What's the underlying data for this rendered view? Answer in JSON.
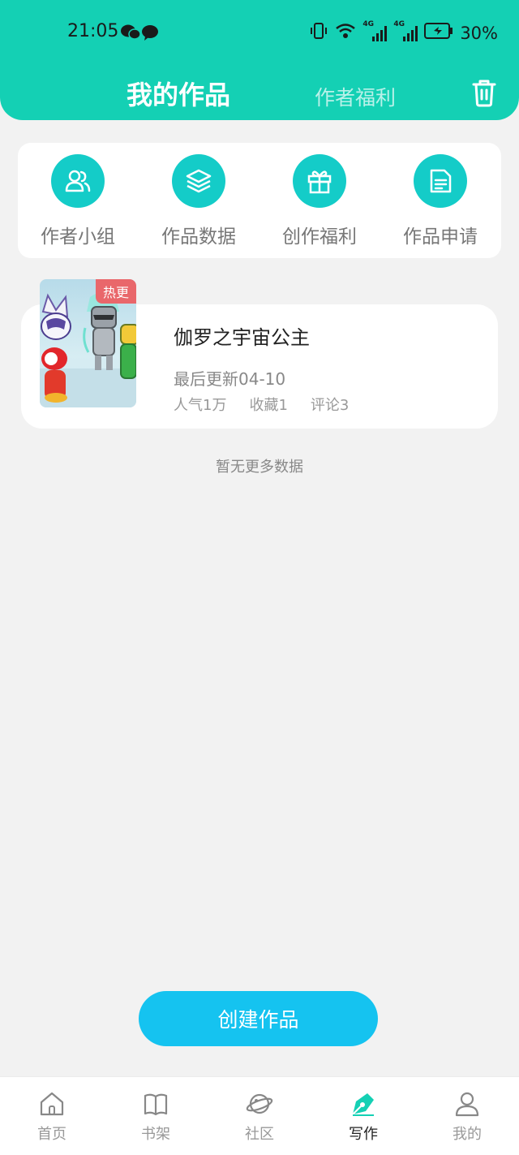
{
  "status_bar": {
    "time": "21:05",
    "network_1": "4G",
    "network_2": "4G",
    "battery": "30%"
  },
  "header": {
    "title": "我的作品",
    "subtitle_tab": "作者福利",
    "trash_icon": "trash-icon",
    "bg_color": "#14d0b4"
  },
  "quick_actions": [
    {
      "label": "作者小组",
      "icon": "group-icon"
    },
    {
      "label": "作品数据",
      "icon": "layers-icon"
    },
    {
      "label": "创作福利",
      "icon": "gift-icon"
    },
    {
      "label": "作品申请",
      "icon": "document-icon"
    }
  ],
  "works": [
    {
      "badge": "热更",
      "title": "伽罗之宇宙公主",
      "last_update": "最后更新04-10",
      "popularity": "人气1万",
      "favorites": "收藏1",
      "comments": "评论3"
    }
  ],
  "no_more_text": "暂无更多数据",
  "create_button": "创建作品",
  "bottom_nav": [
    {
      "label": "首页",
      "icon": "home-icon",
      "active": false
    },
    {
      "label": "书架",
      "icon": "book-icon",
      "active": false
    },
    {
      "label": "社区",
      "icon": "planet-icon",
      "active": false
    },
    {
      "label": "写作",
      "icon": "pen-icon",
      "active": true
    },
    {
      "label": "我的",
      "icon": "user-icon",
      "active": false
    }
  ],
  "colors": {
    "accent": "#14d0b4",
    "button": "#15c3f0",
    "hot_badge": "#e9676b"
  }
}
